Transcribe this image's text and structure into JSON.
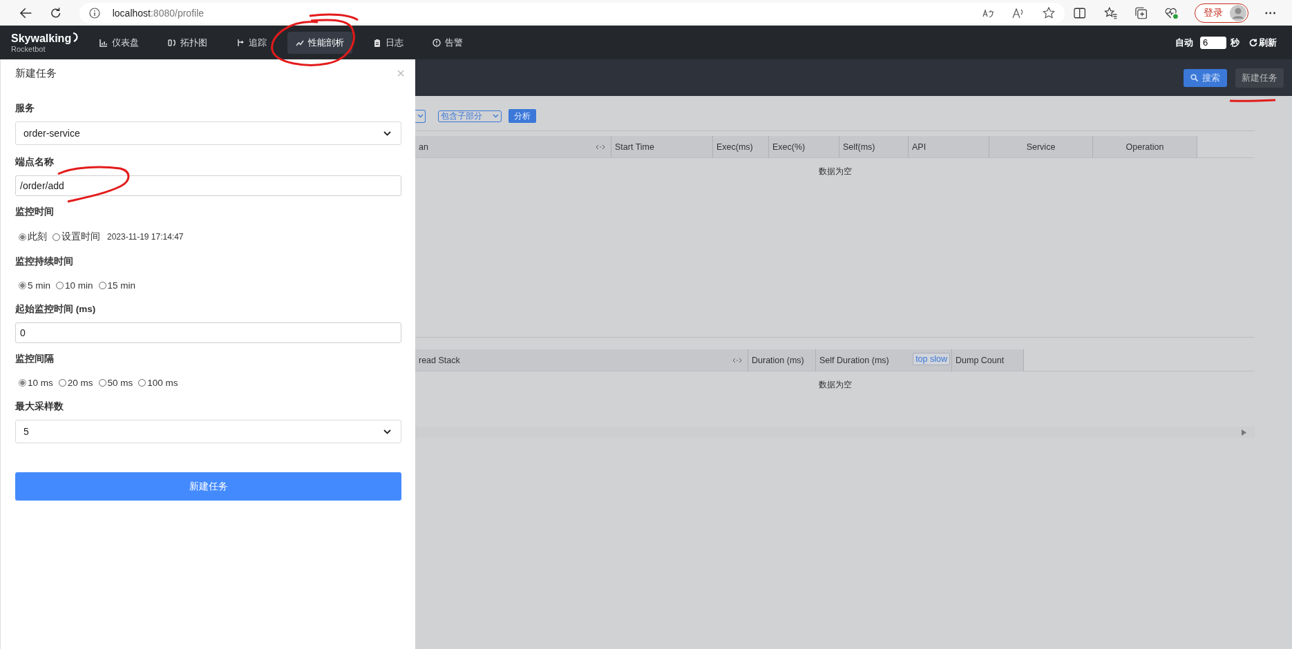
{
  "browser": {
    "url_host": "localhost",
    "url_rest": ":8080/profile",
    "login": "登录"
  },
  "navbar": {
    "logo": "Skywalking",
    "logo_sub": "Rocketbot",
    "items": [
      {
        "label": "仪表盘",
        "selected": false
      },
      {
        "label": "拓扑图",
        "selected": false
      },
      {
        "label": "追踪",
        "selected": false
      },
      {
        "label": "性能剖析",
        "selected": true
      },
      {
        "label": "日志",
        "selected": false
      },
      {
        "label": "告警",
        "selected": false
      }
    ],
    "auto_label": "自动",
    "interval": "6",
    "unit": "秒",
    "refresh": "刷新"
  },
  "subheader": {
    "search": "搜索",
    "new_task": "新建任务"
  },
  "toolbar": {
    "select": "包含子部分",
    "analyze": "分析"
  },
  "span_table": {
    "columns": [
      "an",
      "Start Time",
      "Exec(ms)",
      "Exec(%)",
      "Self(ms)",
      "API",
      "Service",
      "Operation"
    ],
    "empty": "数据为空"
  },
  "stack_table": {
    "columns": [
      "read Stack",
      "Duration (ms)",
      "Self Duration (ms)",
      "Dump Count"
    ],
    "top_slow": "top slow",
    "empty": "数据为空"
  },
  "drawer": {
    "title": "新建任务",
    "close": "×",
    "fields": [
      {
        "kind": "select",
        "label": "服务",
        "value": "order-service"
      },
      {
        "kind": "input",
        "label": "端点名称",
        "value": "/order/add"
      },
      {
        "kind": "radio",
        "label": "监控时间",
        "options": [
          {
            "label": "此刻",
            "selected": true
          },
          {
            "label": "设置时间",
            "selected": false
          }
        ],
        "note": "2023-11-19 17:14:47"
      },
      {
        "kind": "radio",
        "label": "监控持续时间",
        "options": [
          {
            "label": "5 min",
            "selected": true
          },
          {
            "label": "10 min",
            "selected": false
          },
          {
            "label": "15 min",
            "selected": false
          }
        ]
      },
      {
        "kind": "input",
        "label": "起始监控时间 (ms)",
        "value": "0"
      },
      {
        "kind": "radio",
        "label": "监控间隔",
        "options": [
          {
            "label": "10 ms",
            "selected": true
          },
          {
            "label": "20 ms",
            "selected": false
          },
          {
            "label": "50 ms",
            "selected": false
          },
          {
            "label": "100 ms",
            "selected": false
          }
        ]
      },
      {
        "kind": "select",
        "label": "最大采样数",
        "value": "5"
      }
    ],
    "submit": "新建任务"
  }
}
